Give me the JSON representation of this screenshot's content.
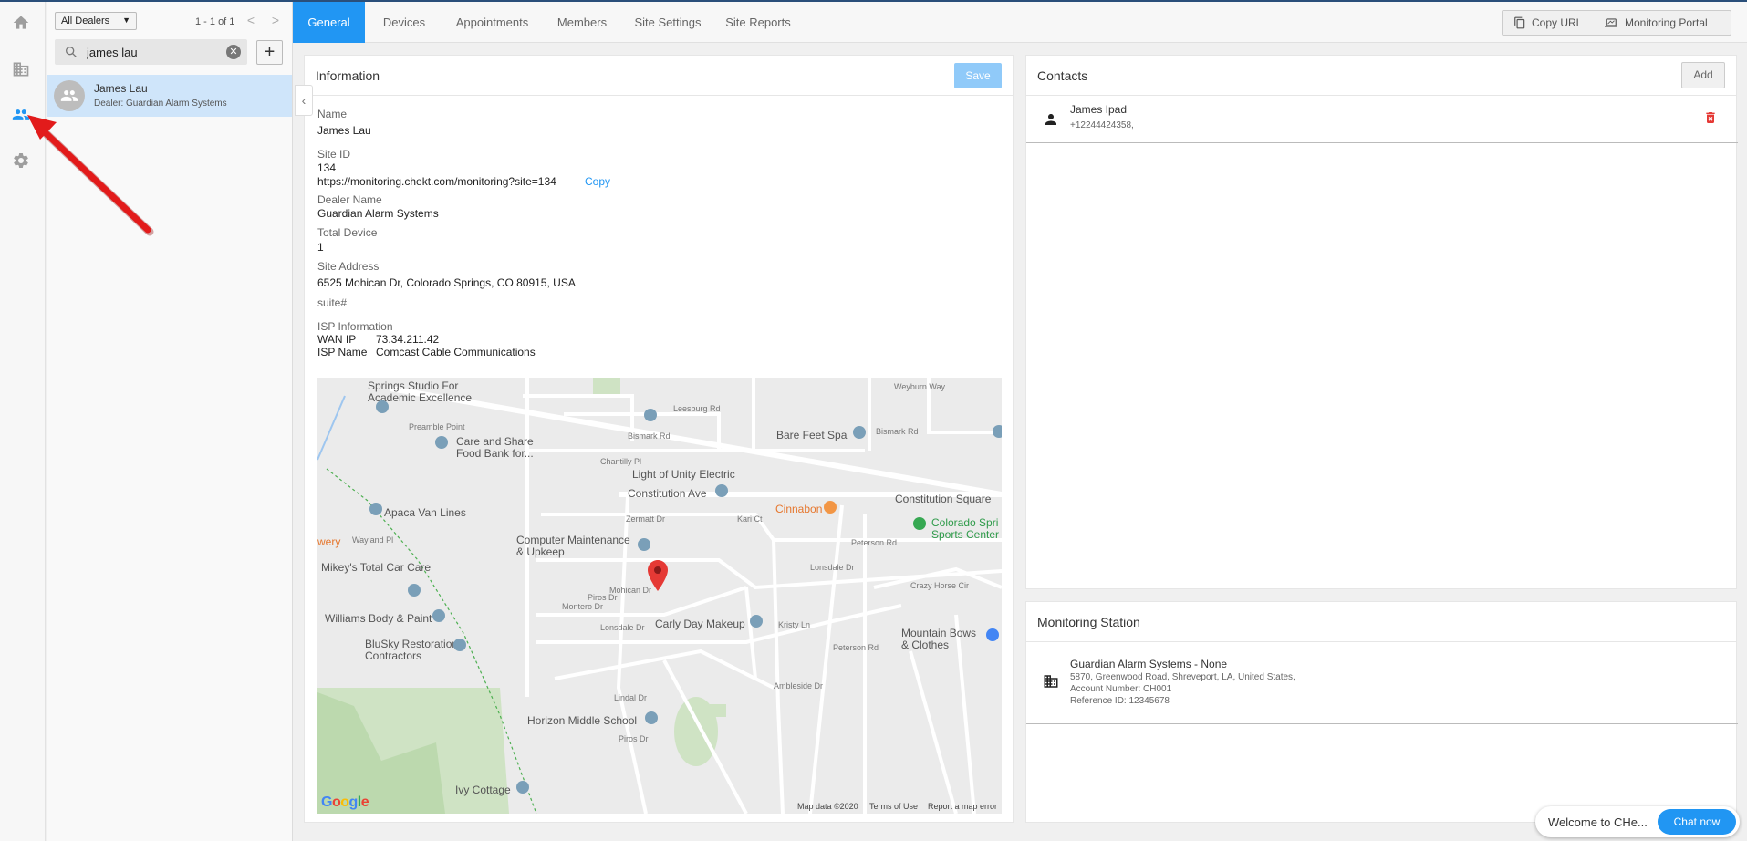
{
  "rail": {
    "items": [
      "home-icon",
      "building-icon",
      "people-icon",
      "gear-icon"
    ],
    "active": "people-icon",
    "active_color": "#2196f3",
    "inactive_color": "#9e9e9e"
  },
  "sitelist": {
    "dealer_filter": "All Dealers",
    "pager_text": "1 - 1 of 1",
    "prev_label": "<",
    "next_label": ">",
    "search_value": "james lau",
    "add_label": "+",
    "items": [
      {
        "name": "James Lau",
        "sub": "Dealer: Guardian Alarm Systems"
      }
    ]
  },
  "tabs": {
    "items": [
      "General",
      "Devices",
      "Appointments",
      "Members",
      "Site Settings",
      "Site Reports"
    ],
    "active": "General",
    "copy_url": "Copy URL",
    "monitoring_portal": "Monitoring Portal"
  },
  "info": {
    "title": "Information",
    "save_label": "Save",
    "name_label": "Name",
    "name_value": "James Lau",
    "site_id_label": "Site ID",
    "site_id_value": "134",
    "url_value": "https://monitoring.chekt.com/monitoring?site=134",
    "copy_label": "Copy",
    "dealer_label": "Dealer Name",
    "dealer_value": "Guardian Alarm Systems",
    "total_device_label": "Total Device",
    "total_device_value": "1",
    "address_label": "Site Address",
    "address_value": "6525 Mohican Dr, Colorado Springs, CO 80915, USA",
    "suite_placeholder": "suite#",
    "isp_label": "ISP Information",
    "wan_ip_label": "WAN IP",
    "wan_ip_value": "73.34.211.42",
    "isp_name_label": "ISP Name",
    "isp_name_value": "Comcast Cable Communications"
  },
  "map": {
    "labels": {
      "springs_studio": "Springs Studio For\nAcademic Excellence",
      "care_share": "Care and Share\nFood Bank for...",
      "bare_feet": "Bare Feet Spa",
      "light_unity": "Light of Unity Electric",
      "constitution_ave": "Constitution Ave",
      "constitution_sq": "Constitution Square",
      "apaca": "Apaca Van Lines",
      "cinnabon": "Cinnabon",
      "colorado_sports": "Colorado Spri\nSports Center",
      "computer_maint": "Computer Maintenance\n& Upkeep",
      "mikeys": "Mikey's Total Car Care",
      "williams": "Williams Body & Paint",
      "blusky": "BluSky Restoration\nContractors",
      "carly": "Carly Day Makeup",
      "mountain_bows": "Mountain Bows\n& Clothes",
      "horizon": "Horizon Middle School",
      "ivy": "Ivy Cottage",
      "wery": "wery",
      "bismark_rd": "Bismark Rd",
      "bismark_rd2": "Bismark Rd",
      "leesburg": "Leesburg Rd",
      "weyburn": "Weyburn Way",
      "chantilly": "Chantilly Pl",
      "zermatt": "Zermatt Dr",
      "kari": "Kari Ct",
      "lonsdale": "Lonsdale Dr",
      "lonsdale2": "Lonsdale Dr",
      "mohican": "Mohican Dr",
      "peterson": "Peterson Rd",
      "peterson2": "Peterson Rd",
      "pros": "Piros Dr",
      "pros2": "Piros Dr",
      "kristy": "Kristy Ln",
      "ambleside": "Ambleside Dr",
      "lindal": "Lindal Dr",
      "crazy_horse": "Crazy Horse Cir",
      "wayland": "Wayland Pl",
      "montero": "Montero Dr",
      "preamble": "Preamble Point"
    },
    "google": "Google",
    "map_data": "Map data ©2020",
    "terms": "Terms of Use",
    "report": "Report a map error"
  },
  "contacts": {
    "title": "Contacts",
    "add_label": "Add",
    "items": [
      {
        "name": "James Ipad",
        "phone": "+12244424358,"
      }
    ]
  },
  "monitoring": {
    "title": "Monitoring Station",
    "name": "Guardian Alarm Systems - None",
    "address": "5870, Greenwood Road, Shreveport, LA, United States,",
    "account": "Account Number: CH001",
    "reference": "Reference ID: 12345678"
  },
  "chat": {
    "welcome": "Welcome to CHe...",
    "chat_now": "Chat now"
  },
  "colors": {
    "accent": "#2196f3",
    "save_disabled": "#90caf9",
    "selected_row": "#cfe5fa",
    "annotation_arrow": "#e21b1b",
    "map_pin": "#e53935"
  }
}
